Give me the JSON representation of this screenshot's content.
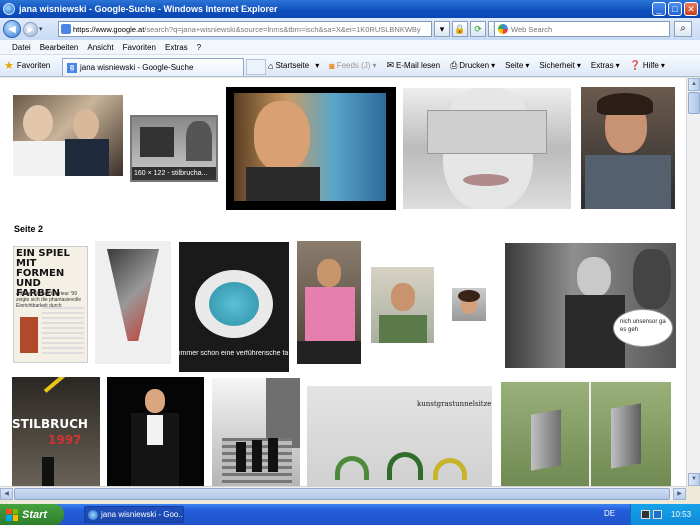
{
  "window": {
    "title": "jana wisniewski - Google-Suche - Windows Internet Explorer"
  },
  "address": {
    "url_prefix": "https://",
    "url_domain": "www.google.at",
    "url_rest": "/search?q=jana+wisniewski&source=lnms&tbm=isch&sa=X&ei=1K0RUSLBNKWBy",
    "search_placeholder": "Web Search"
  },
  "menu": [
    "Datei",
    "Bearbeiten",
    "Ansicht",
    "Favoriten",
    "Extras",
    "?"
  ],
  "favorites_label": "Favoriten",
  "tab_label": "jana wisniewski - Google-Suche",
  "commands": {
    "home": "Startseite",
    "feeds": "Feeds (J)",
    "mail": "E-Mail lesen",
    "print": "Drucken",
    "page": "Seite",
    "security": "Sicherheit",
    "tools": "Extras",
    "help": "Hilfe"
  },
  "content": {
    "page2_label": "Seite 2",
    "hover_caption": "160 × 122 - stilbrucha...",
    "caption_spaghetti": "immer schon eine verführerische fa",
    "poster_title": "EIN SPIEL MIT FORMEN UND FARBEN",
    "poster_text": "Auf der Wiener Interieur '99 zeigte sich die phantasievolle Einrichtbarkeit durch",
    "stilbruch_text": "STILBRUCH",
    "stilbruch_year": "1997",
    "kunst_caption": "kunstgrastunnelsitze",
    "speech_bubble": "nich unsensor ga es geh"
  },
  "taskbar": {
    "start_label": "Start",
    "task_label": "jana wisniewski - Goo...",
    "lang": "DE",
    "clock": "10:53"
  }
}
